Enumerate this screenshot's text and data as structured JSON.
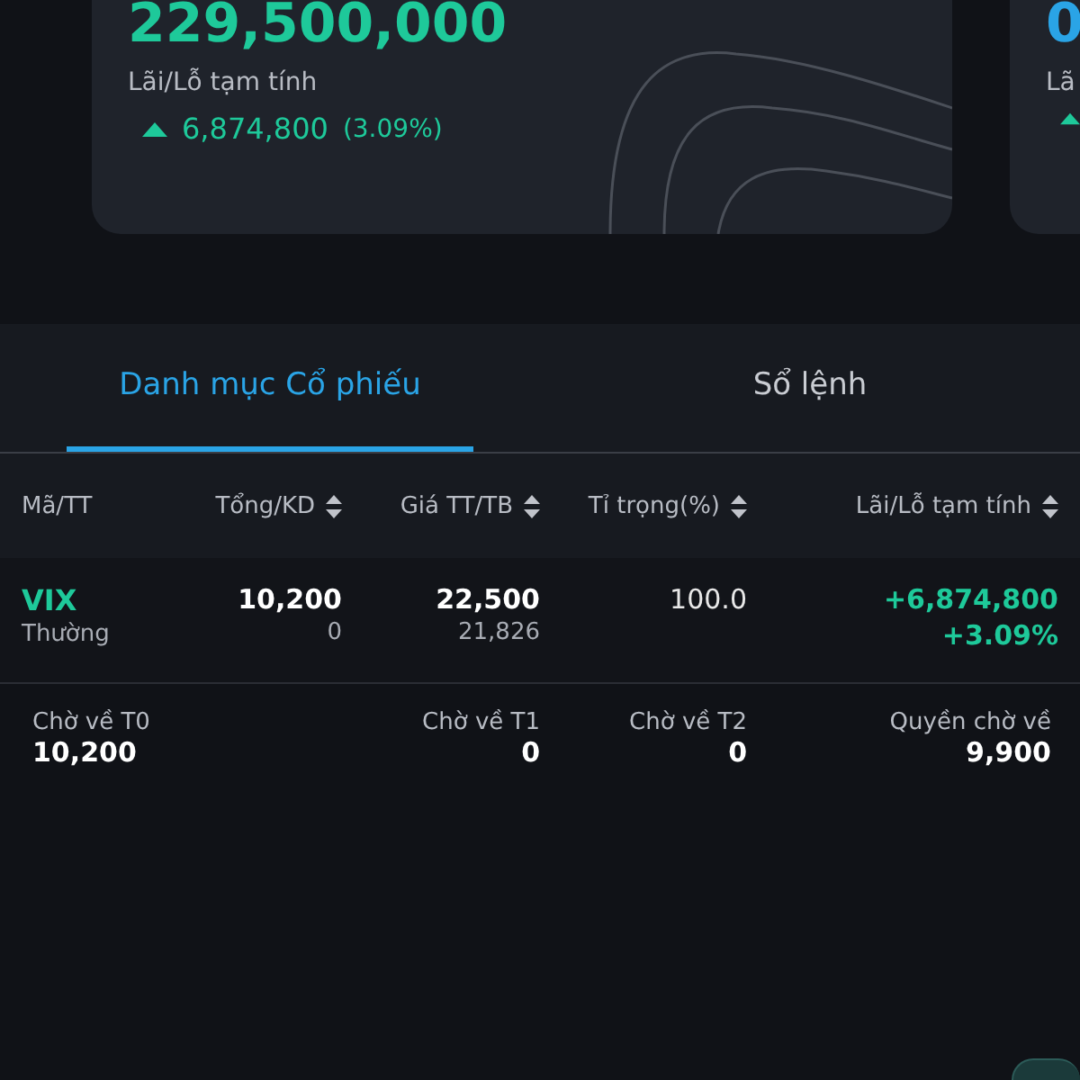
{
  "cards": [
    {
      "value": "229,500,000",
      "color": "#1ec99a",
      "label": "Lãi/Lỗ tạm tính",
      "change": "6,874,800",
      "change_pct": "(3.09%)",
      "rising": true
    },
    {
      "value": "0",
      "color": "#2aa4e6",
      "label": "Lã",
      "rising": true
    }
  ],
  "tabs": [
    {
      "label": "Danh mục Cổ phiếu",
      "selected": true
    },
    {
      "label": "Sổ lệnh",
      "selected": false
    }
  ],
  "table": {
    "columns": [
      {
        "label": "Mã/TT",
        "sortable": false
      },
      {
        "label": "Tổng/KD",
        "sortable": true
      },
      {
        "label": "Giá TT/TB",
        "sortable": true
      },
      {
        "label": "Tỉ trọng(%)",
        "sortable": true
      },
      {
        "label": "Lãi/Lỗ tạm tính",
        "sortable": true
      }
    ],
    "rows": [
      {
        "symbol": "VIX",
        "type": "Thường",
        "total": "10,200",
        "available": "0",
        "price": "22,500",
        "avg_price": "21,826",
        "weight": "100.0",
        "pnl": "+6,874,800",
        "pnl_pct": "+3.09%"
      }
    ]
  },
  "pending": [
    {
      "label": "Chờ về T0",
      "value": "10,200"
    },
    {
      "label": "Chờ về T1",
      "value": "0"
    },
    {
      "label": "Chờ về T2",
      "value": "0"
    },
    {
      "label": "Quyền chờ về",
      "value": "9,900"
    }
  ]
}
